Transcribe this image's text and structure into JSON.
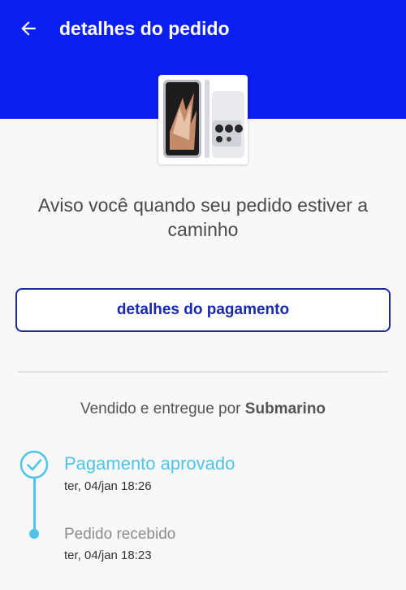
{
  "header": {
    "title": "detalhes do pedido",
    "back_icon": "arrow-left-icon",
    "background_color": "#0a1ff0"
  },
  "product": {
    "image_icon": "smartphone-product-image"
  },
  "notice": {
    "text": "Aviso você quando seu pedido estiver a caminho"
  },
  "payment_button": {
    "label": "detalhes do pagamento"
  },
  "seller": {
    "prefix": "Vendido e entregue por ",
    "name": "Submarino"
  },
  "timeline": {
    "accent_color": "#4fc3e8",
    "steps": [
      {
        "title": "Pagamento aprovado",
        "date": "ter, 04/jan 18:26",
        "icon": "check-circle-icon"
      },
      {
        "title": "Pedido recebido",
        "date": "ter, 04/jan 18:23",
        "icon": "dot-icon"
      }
    ]
  }
}
